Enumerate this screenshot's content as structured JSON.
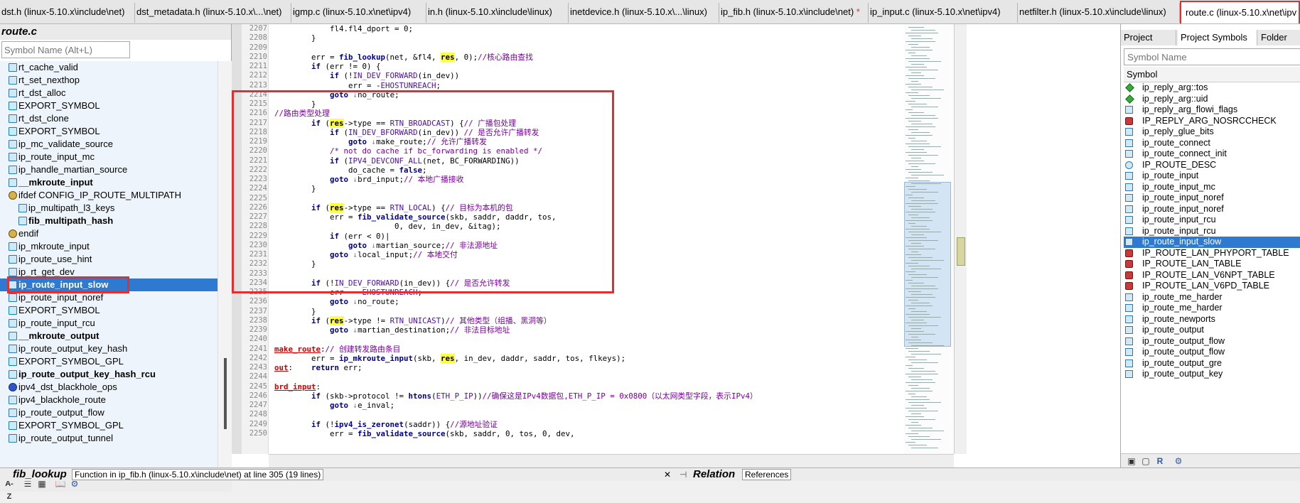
{
  "tabs": [
    {
      "label": "dst.h (linux-5.10.x\\include\\net)"
    },
    {
      "label": "dst_metadata.h (linux-5.10.x\\...\\net)"
    },
    {
      "label": "igmp.c (linux-5.10.x\\net\\ipv4)"
    },
    {
      "label": "in.h (linux-5.10.x\\include\\linux)"
    },
    {
      "label": "inetdevice.h (linux-5.10.x\\...\\linux)"
    },
    {
      "label": "ip_fib.h (linux-5.10.x\\include\\net)",
      "modified": "*"
    },
    {
      "label": "ip_input.c (linux-5.10.x\\net\\ipv4)"
    },
    {
      "label": "netfilter.h (linux-5.10.x\\include\\linux)"
    },
    {
      "label": "route.c (linux-5.10.x\\net\\ipv"
    }
  ],
  "left_panel": {
    "title": "route.c",
    "search_placeholder": "Symbol Name (Alt+L)",
    "symbols": [
      {
        "label": "rt_cache_valid",
        "icon": "function-icon"
      },
      {
        "label": "rt_set_nexthop",
        "icon": "function-icon"
      },
      {
        "label": "rt_dst_alloc",
        "icon": "function-icon"
      },
      {
        "label": "EXPORT_SYMBOL",
        "icon": "export-icon"
      },
      {
        "label": "rt_dst_clone",
        "icon": "function-icon"
      },
      {
        "label": "EXPORT_SYMBOL",
        "icon": "export-icon"
      },
      {
        "label": "ip_mc_validate_source",
        "icon": "function-icon"
      },
      {
        "label": "ip_route_input_mc",
        "icon": "function-icon"
      },
      {
        "label": "ip_handle_martian_source",
        "icon": "function-icon"
      },
      {
        "label": "__mkroute_input",
        "icon": "function-icon",
        "bold": true
      },
      {
        "label": "ifdef CONFIG_IP_ROUTE_MULTIPATH",
        "icon": "ifdef-icon"
      },
      {
        "label": "ip_multipath_l3_keys",
        "icon": "function-icon",
        "indent": true
      },
      {
        "label": "fib_multipath_hash",
        "icon": "function-icon",
        "indent": true,
        "bold": true
      },
      {
        "label": "endif",
        "icon": "ifdef-icon"
      },
      {
        "label": "ip_mkroute_input",
        "icon": "function-icon"
      },
      {
        "label": "ip_route_use_hint",
        "icon": "function-icon"
      },
      {
        "label": "ip_rt_get_dev",
        "icon": "function-icon"
      },
      {
        "label": "ip_route_input_slow",
        "icon": "function-icon",
        "bold": true,
        "selected": true
      },
      {
        "label": "ip_route_input_noref",
        "icon": "function-icon"
      },
      {
        "label": "EXPORT_SYMBOL",
        "icon": "export-icon"
      },
      {
        "label": "ip_route_input_rcu",
        "icon": "function-icon"
      },
      {
        "label": "__mkroute_output",
        "icon": "function-icon",
        "bold": true
      },
      {
        "label": "ip_route_output_key_hash",
        "icon": "function-icon"
      },
      {
        "label": "EXPORT_SYMBOL_GPL",
        "icon": "export-icon"
      },
      {
        "label": "ip_route_output_key_hash_rcu",
        "icon": "function-icon",
        "bold": true
      },
      {
        "label": "ipv4_dst_blackhole_ops",
        "icon": "struct-icon"
      },
      {
        "label": "ipv4_blackhole_route",
        "icon": "function-icon"
      },
      {
        "label": "ip_route_output_flow",
        "icon": "function-icon"
      },
      {
        "label": "EXPORT_SYMBOL_GPL",
        "icon": "export-icon"
      },
      {
        "label": "ip_route_output_tunnel",
        "icon": "function-icon"
      }
    ]
  },
  "editor": {
    "lines": [
      {
        "n": "2207",
        "html": "            fl4.fl4_dport = 0;"
      },
      {
        "n": "2208",
        "html": "        }"
      },
      {
        "n": "2209",
        "html": ""
      },
      {
        "n": "2210",
        "html": "        err = <span class=\"fn\">fib_lookup</span>(net, &amp;fl4, <span class=\"hl\">res</span>, 0);<span class=\"cm\">//核心路由查找</span>"
      },
      {
        "n": "2211",
        "html": "        <span class=\"kw\">if</span> (err != 0) {"
      },
      {
        "n": "2212",
        "html": "            <span class=\"kw\">if</span> (!<span class=\"mac\">IN_DEV_FORWARD</span>(in_dev))"
      },
      {
        "n": "2213",
        "html": "                err = -<span class=\"mac\">EHOSTUNREACH</span>;"
      },
      {
        "n": "2214",
        "html": "            <span class=\"kw\">goto</span> <span class=\"arrow\">↓</span>no_route;"
      },
      {
        "n": "2215",
        "html": "        }"
      },
      {
        "n": "2216",
        "html": "<span class=\"cm\">//路由类型处理</span>"
      },
      {
        "n": "2217",
        "html": "        <span class=\"kw\">if</span> (<span class=\"hl\">res</span>-&gt;type == <span class=\"mac\">RTN_BROADCAST</span>) {<span class=\"cm\">// 广播包处理</span>"
      },
      {
        "n": "2218",
        "html": "            <span class=\"kw\">if</span> (<span class=\"mac\">IN_DEV_BFORWARD</span>(in_dev)) <span class=\"cm\">// 是否允许广播转发</span>"
      },
      {
        "n": "2219",
        "html": "                <span class=\"kw\">goto</span> <span class=\"arrow\">↓</span>make_route;<span class=\"cm\">// 允许广播转发</span>"
      },
      {
        "n": "2220",
        "html": "            <span class=\"cm\">/* not do cache if bc_forwarding is enabled */</span>"
      },
      {
        "n": "2221",
        "html": "            <span class=\"kw\">if</span> (<span class=\"mac\">IPV4_DEVCONF_ALL</span>(net, BC_FORWARDING))"
      },
      {
        "n": "2222",
        "html": "                do_cache = <span class=\"kw\">false</span>;"
      },
      {
        "n": "2223",
        "html": "            <span class=\"kw\">goto</span> <span class=\"arrow\">↓</span>brd_input;<span class=\"cm\">// 本地广播接收</span>"
      },
      {
        "n": "2224",
        "html": "        }"
      },
      {
        "n": "2225",
        "html": ""
      },
      {
        "n": "2226",
        "html": "        <span class=\"kw\">if</span> (<span class=\"hl\">res</span>-&gt;type == <span class=\"mac\">RTN_LOCAL</span>) {<span class=\"cm\">// 目标为本机的包</span>"
      },
      {
        "n": "2227",
        "html": "            err = <span class=\"fn\">fib_validate_source</span>(skb, saddr, daddr, tos,"
      },
      {
        "n": "2228",
        "html": "                          0, dev, in_dev, &amp;itag);"
      },
      {
        "n": "2229",
        "html": "            <span class=\"kw\">if</span> (err &lt; 0)|"
      },
      {
        "n": "2230",
        "html": "                <span class=\"kw\">goto</span> <span class=\"arrow\">↓</span>martian_source;<span class=\"cm\">// 非法源地址</span>"
      },
      {
        "n": "2231",
        "html": "            <span class=\"kw\">goto</span> <span class=\"arrow\">↓</span>local_input;<span class=\"cm\">// 本地交付</span>"
      },
      {
        "n": "2232",
        "html": "        }"
      },
      {
        "n": "2233",
        "html": ""
      },
      {
        "n": "2234",
        "html": "        <span class=\"kw\">if</span> (!<span class=\"mac\">IN_DEV_FORWARD</span>(in_dev)) {<span class=\"cm\">// 是否允许转发</span>"
      },
      {
        "n": "2235",
        "html": "            err = -<span class=\"mac\">EHOSTUNREACH</span>;"
      },
      {
        "n": "2236",
        "html": "            <span class=\"kw\">goto</span> <span class=\"arrow\">↓</span>no_route;"
      },
      {
        "n": "2237",
        "html": "        }"
      },
      {
        "n": "2238",
        "html": "        <span class=\"kw\">if</span> (<span class=\"hl\">res</span>-&gt;type != <span class=\"mac\">RTN_UNICAST</span>)<span class=\"cm\">// 其他类型（组播、黑洞等）</span>"
      },
      {
        "n": "2239",
        "html": "            <span class=\"kw\">goto</span> <span class=\"arrow\">↓</span>martian_destination;<span class=\"cm\">// 非法目标地址</span>"
      },
      {
        "n": "2240",
        "html": ""
      },
      {
        "n": "2241",
        "html": "<span class=\"lbl\">make_route</span>:<span class=\"cm\">// 创建转发路由条目</span>"
      },
      {
        "n": "2242",
        "html": "        err = <span class=\"fn\">ip_mkroute_input</span>(skb, <span class=\"hl\">res</span>, in_dev, daddr, saddr, tos, flkeys);"
      },
      {
        "n": "2243",
        "html": "<span class=\"lbl\">out</span>:    <span class=\"kw\">return</span> err;"
      },
      {
        "n": "2244",
        "html": ""
      },
      {
        "n": "2245",
        "html": "<span class=\"lbl\">brd_input</span>:"
      },
      {
        "n": "2246",
        "html": "        <span class=\"kw\">if</span> (skb-&gt;protocol != <span class=\"fn\">htons</span>(<span class=\"mac\">ETH_P_IP</span>))<span class=\"cm\">//确保这是IPv4数据包,ETH_P_IP = 0x0800（以太网类型字段，表示IPv4）</span>"
      },
      {
        "n": "2247",
        "html": "            <span class=\"kw\">goto</span> <span class=\"arrow\">↓</span>e_inval;"
      },
      {
        "n": "2248",
        "html": ""
      },
      {
        "n": "2249",
        "html": "        <span class=\"kw\">if</span> (!<span class=\"fn\">ipv4_is_zeronet</span>(saddr)) {<span class=\"cm\">//源地址验证</span>"
      },
      {
        "n": "2250",
        "html": "            err = <span class=\"fn\">fib_validate_source</span>(skb, saddr, 0, tos, 0, dev,"
      }
    ]
  },
  "right_panel": {
    "tabs": [
      "Project Files",
      "Project Symbols",
      "Folder"
    ],
    "search_placeholder": "Symbol Name",
    "header": "Symbol",
    "symbols": [
      {
        "label": "ip_reply_arg::tos",
        "icon": "diamond"
      },
      {
        "label": "ip_reply_arg::uid",
        "icon": "diamond"
      },
      {
        "label": "ip_reply_arg_flowi_flags",
        "icon": "function"
      },
      {
        "label": "IP_REPLY_ARG_NOSRCCHECK",
        "icon": "hash"
      },
      {
        "label": "ip_reply_glue_bits",
        "icon": "function"
      },
      {
        "label": "ip_route_connect",
        "icon": "function"
      },
      {
        "label": "ip_route_connect_init",
        "icon": "function"
      },
      {
        "label": "IP_ROUTE_DESC",
        "icon": "struct"
      },
      {
        "label": "ip_route_input",
        "icon": "function"
      },
      {
        "label": "ip_route_input_mc",
        "icon": "function"
      },
      {
        "label": "ip_route_input_noref",
        "icon": "function"
      },
      {
        "label": "ip_route_input_noref",
        "icon": "function"
      },
      {
        "label": "ip_route_input_rcu",
        "icon": "function"
      },
      {
        "label": "ip_route_input_rcu",
        "icon": "function"
      },
      {
        "label": "ip_route_input_slow",
        "icon": "function",
        "selected": true
      },
      {
        "label": "IP_ROUTE_LAN_PHYPORT_TABLE",
        "icon": "hash"
      },
      {
        "label": "IP_ROUTE_LAN_TABLE",
        "icon": "hash"
      },
      {
        "label": "IP_ROUTE_LAN_V6NPT_TABLE",
        "icon": "hash"
      },
      {
        "label": "IP_ROUTE_LAN_V6PD_TABLE",
        "icon": "hash"
      },
      {
        "label": "ip_route_me_harder",
        "icon": "function"
      },
      {
        "label": "ip_route_me_harder",
        "icon": "function"
      },
      {
        "label": "ip_route_newports",
        "icon": "function"
      },
      {
        "label": "ip_route_output",
        "icon": "function"
      },
      {
        "label": "ip_route_output_flow",
        "icon": "function"
      },
      {
        "label": "ip_route_output_flow",
        "icon": "function"
      },
      {
        "label": "ip_route_output_gre",
        "icon": "function"
      },
      {
        "label": "ip_route_output_key",
        "icon": "function"
      }
    ]
  },
  "status": {
    "function_name": "fib_lookup",
    "description": "Function in ip_fib.h (linux-5.10.x\\include\\net) at line 305 (19 lines)",
    "relation_label": "Relation",
    "references_label": "References"
  }
}
